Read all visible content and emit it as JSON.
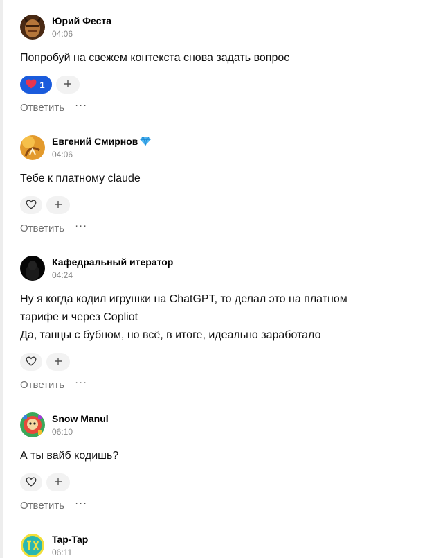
{
  "comments": [
    {
      "author": "Юрий Феста",
      "time": "04:06",
      "text": "Попробуй на свежем контекста снова задать вопрос",
      "reaction_count": "1",
      "reply_label": "Ответить"
    },
    {
      "author": "Евгений Смирнов",
      "time": "04:06",
      "text": "Тебе к платному claude",
      "reply_label": "Ответить"
    },
    {
      "author": "Кафедральный итератор",
      "time": "04:24",
      "lines": [
        "Ну я когда кодил игрушки на ChatGPT, то делал это на платном",
        "тарифе и через Copliot",
        "Да, танцы с бубном, но всё, в итоге, идеально заработало"
      ],
      "reply_label": "Ответить"
    },
    {
      "author": "Snow Manul",
      "time": "06:10",
      "text": "А ты вайб кодишь?",
      "reply_label": "Ответить"
    },
    {
      "author": "Tap-Tap",
      "time": "06:11"
    }
  ],
  "colors": {
    "accent": "#1a5bdc",
    "heart": "#e8354d",
    "muted": "#707070",
    "pill_bg": "#f2f2f2"
  },
  "icons": {
    "like": "heart-outline-icon",
    "liked": "heart-filled-icon",
    "add": "plus-icon",
    "more": "more-dots-icon",
    "verified": "diamond-icon"
  }
}
